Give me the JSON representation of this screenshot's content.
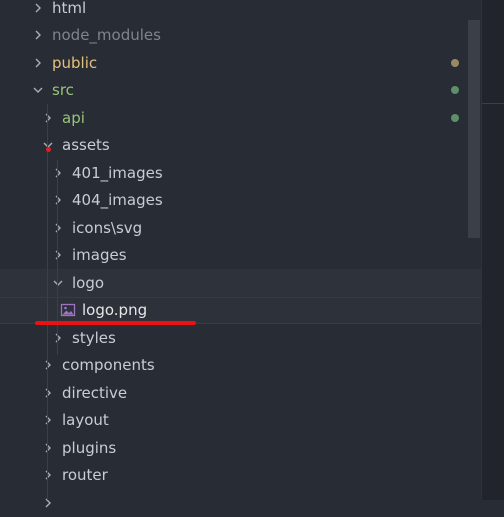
{
  "explorer": {
    "items": [
      {
        "label": "html",
        "state": "collapsed",
        "color": "#c8ccd4"
      },
      {
        "label": "node_modules",
        "state": "collapsed",
        "color": "#7f848e"
      },
      {
        "label": "public",
        "state": "collapsed",
        "color": "#e5c07b",
        "status_dot": "#9a8a64"
      },
      {
        "label": "src",
        "state": "expanded",
        "color": "#98c379",
        "status_dot": "#5e8f6a"
      },
      {
        "label": "api",
        "state": "collapsed",
        "color": "#98c379",
        "status_dot": "#5e8f6a"
      },
      {
        "label": "assets",
        "state": "expanded",
        "color": "#c8ccd4"
      },
      {
        "label": "401_images",
        "state": "collapsed",
        "color": "#c8ccd4"
      },
      {
        "label": "404_images",
        "state": "collapsed",
        "color": "#c8ccd4"
      },
      {
        "label": "icons\\svg",
        "state": "collapsed",
        "color": "#c8ccd4"
      },
      {
        "label": "images",
        "state": "collapsed",
        "color": "#c8ccd4"
      },
      {
        "label": "logo",
        "state": "expanded",
        "color": "#c8ccd4"
      },
      {
        "label": "logo.png",
        "state": "file",
        "color": "#e6e6e6",
        "icon": "image-file-icon"
      },
      {
        "label": "styles",
        "state": "collapsed",
        "color": "#c8ccd4"
      },
      {
        "label": "components",
        "state": "collapsed",
        "color": "#c8ccd4"
      },
      {
        "label": "directive",
        "state": "collapsed",
        "color": "#c8ccd4"
      },
      {
        "label": "layout",
        "state": "collapsed",
        "color": "#c8ccd4"
      },
      {
        "label": "plugins",
        "state": "collapsed",
        "color": "#c8ccd4"
      },
      {
        "label": "router",
        "state": "collapsed",
        "color": "#c8ccd4"
      }
    ]
  },
  "colors": {
    "background": "#282c34",
    "annotation_red": "#ee1111",
    "git_modified": "#9a8a64",
    "git_untracked": "#5e8f6a"
  }
}
